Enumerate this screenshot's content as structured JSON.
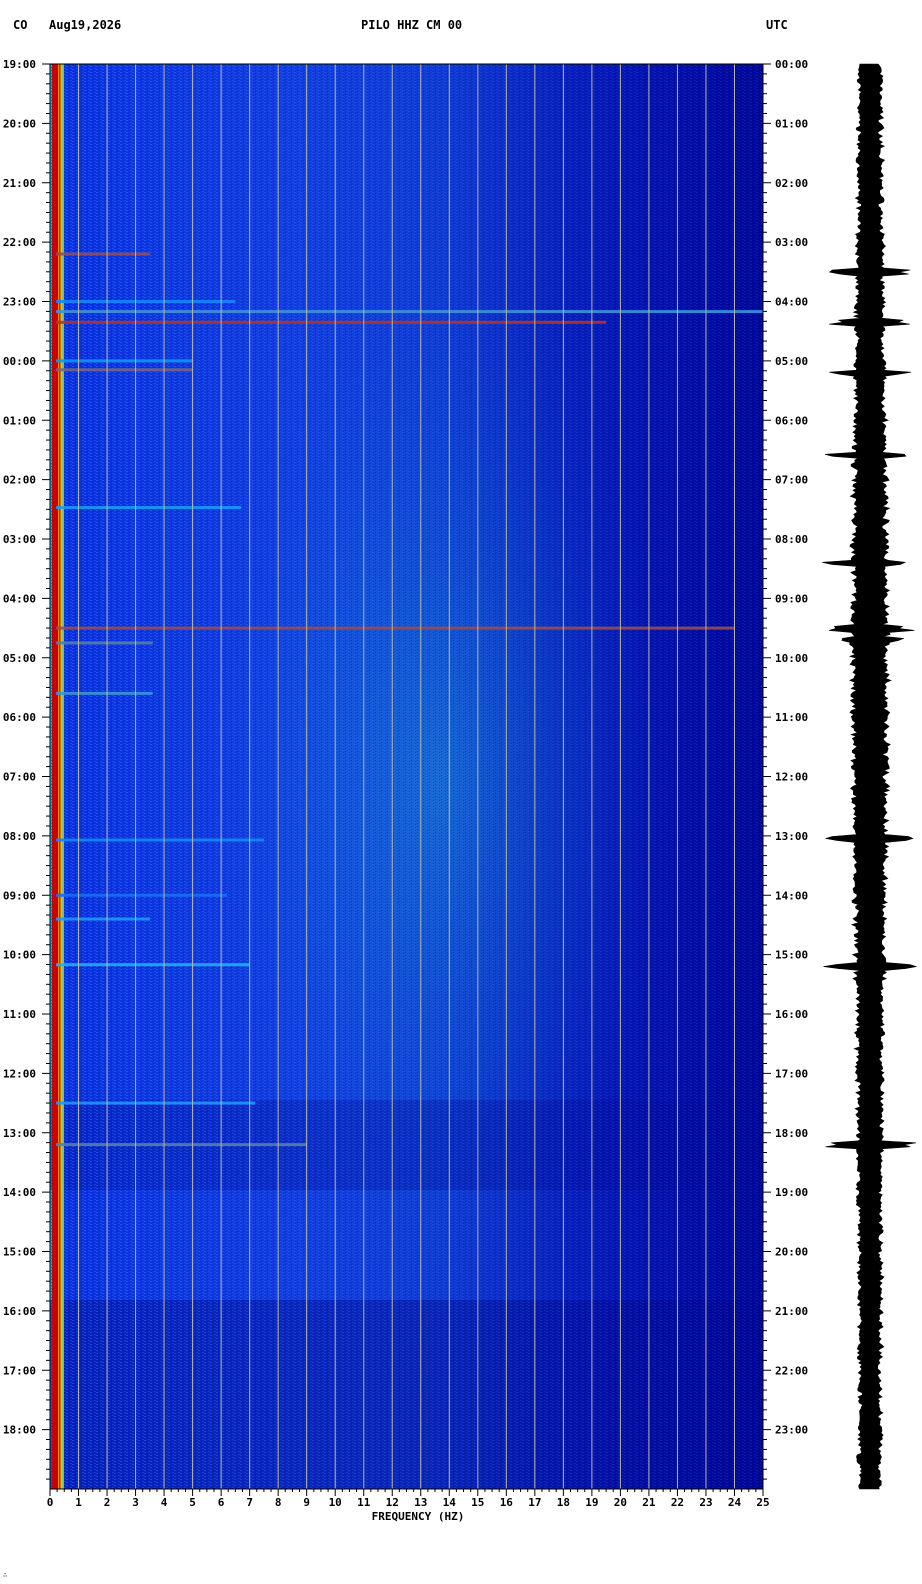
{
  "header": {
    "network": "CO",
    "date": "Aug19,2026",
    "station": "PILO HHZ CM 00",
    "timezone": "UTC"
  },
  "chart_data": {
    "type": "heatmap",
    "title": "PILO HHZ CM 00",
    "xlabel": "FREQUENCY (HZ)",
    "ylabel": "",
    "x_ticks": [
      0,
      1,
      2,
      3,
      4,
      5,
      6,
      7,
      8,
      9,
      10,
      11,
      12,
      13,
      14,
      15,
      16,
      17,
      18,
      19,
      20,
      21,
      22,
      23,
      24,
      25
    ],
    "xlim": [
      0,
      25
    ],
    "left_time_ticks": [
      "19:00",
      "20:00",
      "21:00",
      "22:00",
      "23:00",
      "00:00",
      "01:00",
      "02:00",
      "03:00",
      "04:00",
      "05:00",
      "06:00",
      "07:00",
      "08:00",
      "09:00",
      "10:00",
      "11:00",
      "12:00",
      "13:00",
      "14:00",
      "15:00",
      "16:00",
      "17:00",
      "18:00"
    ],
    "right_time_ticks": [
      "00:00",
      "01:00",
      "02:00",
      "03:00",
      "04:00",
      "05:00",
      "06:00",
      "07:00",
      "08:00",
      "09:00",
      "10:00",
      "11:00",
      "12:00",
      "13:00",
      "14:00",
      "15:00",
      "16:00",
      "17:00",
      "18:00",
      "19:00",
      "20:00",
      "21:00",
      "22:00",
      "23:00"
    ],
    "duration_hours": 24,
    "grid": true,
    "colors": {
      "background": "#00008f",
      "low": "#0a1fd8",
      "mid": "#19b0ff",
      "high": "#d41a00",
      "grid": "#b8b8a8"
    },
    "events": [
      {
        "hour": 3.2,
        "fmax": 3.5,
        "level": 0.9
      },
      {
        "hour": 4.0,
        "fmax": 6.5,
        "level": 0.5
      },
      {
        "hour": 4.17,
        "fmax": 25.0,
        "level": 0.75
      },
      {
        "hour": 4.35,
        "fmax": 19.5,
        "level": 0.95
      },
      {
        "hour": 5.0,
        "fmax": 5.0,
        "level": 0.55
      },
      {
        "hour": 5.15,
        "fmax": 5.0,
        "level": 0.85
      },
      {
        "hour": 7.47,
        "fmax": 6.7,
        "level": 0.6
      },
      {
        "hour": 9.5,
        "fmax": 24.0,
        "level": 0.9
      },
      {
        "hour": 9.75,
        "fmax": 3.6,
        "level": 0.8
      },
      {
        "hour": 10.6,
        "fmax": 3.6,
        "level": 0.75
      },
      {
        "hour": 13.07,
        "fmax": 7.5,
        "level": 0.5
      },
      {
        "hour": 14.0,
        "fmax": 6.2,
        "level": 0.4
      },
      {
        "hour": 14.4,
        "fmax": 3.5,
        "level": 0.6
      },
      {
        "hour": 15.17,
        "fmax": 7.0,
        "level": 0.7
      },
      {
        "hour": 17.5,
        "fmax": 7.2,
        "level": 0.6
      },
      {
        "hour": 18.2,
        "fmax": 9.0,
        "level": 0.8
      }
    ],
    "waveform": {
      "baseline_amplitude": 0.2,
      "spike_hours": [
        3.5,
        4.35,
        5.2,
        6.6,
        8.4,
        9.5,
        9.7,
        13.05,
        15.2,
        18.2
      ]
    }
  },
  "corner_mark": "∴"
}
